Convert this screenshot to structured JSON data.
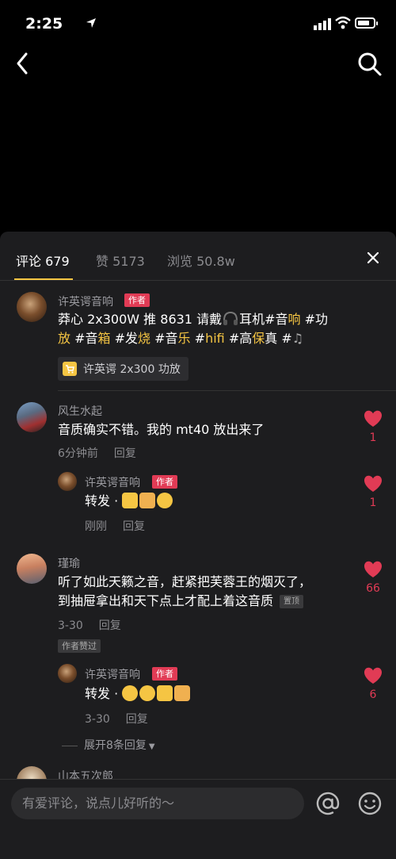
{
  "status": {
    "time": "2:25"
  },
  "tabs": [
    {
      "label": "评论 679"
    },
    {
      "label": "赞 5173"
    },
    {
      "label": "浏览 50.8w"
    }
  ],
  "author_badge": "作者",
  "comments": [
    {
      "user": "许英谔音响",
      "text_parts": [
        "莽心 2x300W 推 8631 请戴",
        "耳机#音",
        "响",
        " #功",
        "放",
        " #音",
        "箱",
        " #发",
        "烧",
        " #音",
        "乐",
        " #",
        "hifi",
        " #高",
        "保",
        "真",
        " #"
      ],
      "product": "许英谔 2x300 功放"
    },
    {
      "user": "风生水起",
      "text": "音质确实不错。我的 mt40 放出来了",
      "time": "6分钟前",
      "reply": "回复",
      "likes": "1",
      "replies": [
        {
          "user": "许英谔音响",
          "text": "转发 · ",
          "time": "刚刚",
          "reply": "回复",
          "likes": "1"
        }
      ]
    },
    {
      "user": "瑾瑜",
      "text_line1": "听了如此天籁之音，赶紧把芙蓉王的烟灭了，",
      "text_line2": "到抽屉拿出和天下点上才配上着这音质",
      "pinned": "置顶",
      "time": "3-30",
      "reply": "回复",
      "liked_by_author": "作者赞过",
      "likes": "66",
      "replies": [
        {
          "user": "许英谔音响",
          "text": "转发 · ",
          "time": "3-30",
          "reply": "回复",
          "likes": "6"
        }
      ],
      "expand": "展开8条回复"
    },
    {
      "user": "山本五次郎"
    }
  ],
  "input": {
    "placeholder": "有爱评论，说点儿好听的～"
  },
  "colors": {
    "accent": "#f5c543",
    "like": "#e13b55",
    "badge": "#e13b55",
    "sheet": "#1d1d1f"
  }
}
